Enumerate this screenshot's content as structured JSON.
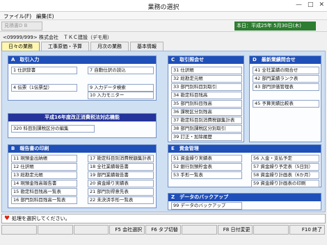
{
  "window": {
    "title": "業務の選択",
    "buttons": [
      "—",
      "□",
      "✕"
    ]
  },
  "menu": [
    "ファイル(F)",
    "編集(E)"
  ],
  "toolbar": {
    "left_button": "見積書D B",
    "date": "本日：平成25年 5月30日(木)"
  },
  "company": "<09999/999> 株式会社　ＴＫＣ建設（デモ用）",
  "tabs": [
    {
      "label": "日々の業務",
      "active": true
    },
    {
      "label": "工事原価・予算",
      "active": false
    },
    {
      "label": "月次の業務",
      "active": false
    },
    {
      "label": "基本情報",
      "active": false
    }
  ],
  "sections": {
    "A": {
      "title": "A　取引入力",
      "items": [
        "1 仕訳辞書",
        "7 自動仕訳の読込",
        "4 伝票（1伝票型）",
        "9 入力データ検索",
        "10 入力モニター"
      ]
    },
    "C": {
      "title": "C　取引照会せ",
      "items": [
        "31 仕訳帳",
        "32 総勘定元帳",
        "33 部門別科目別取引",
        "34 勘定科目残高",
        "35 部門別科目残高",
        "36 課税区分別残高",
        "37 勘定科目別消費税額集計表",
        "38 部門別課税区分別取引",
        "39 訂正・加除履歴"
      ]
    },
    "D": {
      "title": "D　最新業績問合せ",
      "items": [
        "41 全社業績の問合せ",
        "42 部門業績ランク表",
        "43 部門評価管理表",
        "45 予算実績比較表"
      ]
    },
    "tax": {
      "title": "平成16年度改正消費税法対応機能",
      "items": [
        "320 科目別課税区分の編集"
      ]
    },
    "B": {
      "title": "B　報告書の印刷",
      "items": [
        "11 現預金出納帳",
        "17 勘定科目別消費税額集計表",
        "12 仕訳帳",
        "18 全社業績報告書",
        "13 総勘定元帳",
        "19 部門業績報告書",
        "14 現預金残高報告書",
        "20 資金繰り実績表",
        "15 勘定科目残高一覧表",
        "21 部門別得意先表",
        "16 部門別科目残高一覧表",
        "22 未決済手形一覧表"
      ]
    },
    "E": {
      "title": "E　資金管理",
      "items": [
        "51 資金繰り実績表",
        "56 入金・支払予定",
        "52 銀行別預貯金表",
        "57 資金繰り予定表（5日別）",
        "53 手形一覧表",
        "58 資金繰り計画表（6か月）",
        "59 資金繰り計画表の印刷"
      ]
    },
    "Z": {
      "title": "Z　データのバックアップ",
      "items": [
        "99 データのバックアップ"
      ]
    }
  },
  "status": {
    "text": "処理を選択してください。"
  },
  "fkeys": [
    "",
    "",
    "",
    "F5 会社選択",
    "F6 タブ切替",
    "",
    "F8 日付変更",
    "",
    "F10 終了"
  ]
}
